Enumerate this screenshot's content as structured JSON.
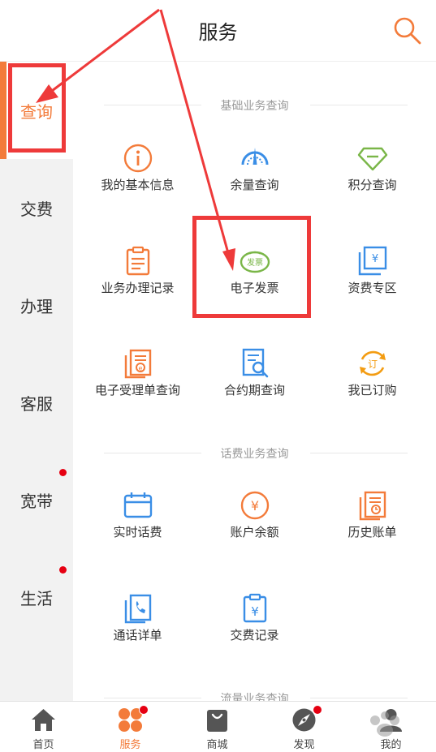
{
  "header": {
    "title": "服务"
  },
  "sidebar": {
    "items": [
      {
        "label": "查询",
        "active": true,
        "dot": false
      },
      {
        "label": "交费",
        "active": false,
        "dot": false
      },
      {
        "label": "办理",
        "active": false,
        "dot": false
      },
      {
        "label": "客服",
        "active": false,
        "dot": false
      },
      {
        "label": "宽带",
        "active": false,
        "dot": true
      },
      {
        "label": "生活",
        "active": false,
        "dot": true
      }
    ]
  },
  "sections": [
    {
      "title": "基础业务查询",
      "items": [
        {
          "label": "我的基本信息",
          "icon": "info-icon"
        },
        {
          "label": "余量查询",
          "icon": "gauge-icon"
        },
        {
          "label": "积分查询",
          "icon": "diamond-icon"
        },
        {
          "label": "业务办理记录",
          "icon": "clipboard-icon"
        },
        {
          "label": "电子发票",
          "icon": "invoice-icon",
          "icon_text": "发票"
        },
        {
          "label": "资费专区",
          "icon": "tariff-icon"
        },
        {
          "label": "电子受理单查询",
          "icon": "receipt-icon"
        },
        {
          "label": "合约期查询",
          "icon": "contract-search-icon"
        },
        {
          "label": "我已订购",
          "icon": "subscribed-icon",
          "icon_text": "订"
        }
      ]
    },
    {
      "title": "话费业务查询",
      "items": [
        {
          "label": "实时话费",
          "icon": "calendar-icon"
        },
        {
          "label": "账户余额",
          "icon": "yuan-circle-icon"
        },
        {
          "label": "历史账单",
          "icon": "history-bill-icon"
        },
        {
          "label": "通话详单",
          "icon": "call-detail-icon"
        },
        {
          "label": "交费记录",
          "icon": "payment-record-icon"
        }
      ]
    },
    {
      "title": "流量业务查询",
      "items": []
    }
  ],
  "bottom_nav": [
    {
      "label": "首页",
      "icon": "home-icon",
      "active": false,
      "dot": false
    },
    {
      "label": "服务",
      "icon": "service-icon",
      "active": true,
      "dot": true
    },
    {
      "label": "商城",
      "icon": "shop-bag-icon",
      "active": false,
      "dot": false
    },
    {
      "label": "发现",
      "icon": "compass-icon",
      "active": false,
      "dot": true
    },
    {
      "label": "我的",
      "icon": "user-icon",
      "active": false,
      "dot": false
    }
  ],
  "colors": {
    "accent": "#f37b3a",
    "blue": "#3a8ee6",
    "green": "#7ab648",
    "annotation": "#ee3a3a",
    "badge": "#e60012"
  }
}
